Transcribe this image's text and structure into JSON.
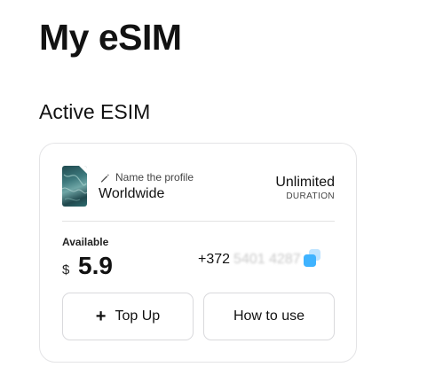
{
  "header": {
    "title": "My eSIM"
  },
  "section": {
    "title": "Active ESIM"
  },
  "esim_card": {
    "profile": {
      "name_hint": "Name the profile",
      "name": "Worldwide",
      "thumbnail_icon": "sim-card-image",
      "edit_icon": "pencil-icon"
    },
    "duration": {
      "value": "Unlimited",
      "label": "DURATION"
    },
    "balance": {
      "label": "Available",
      "currency": "$",
      "amount": "5.9"
    },
    "phone": {
      "prefix": "+372",
      "masked": "5401 4287",
      "copy_icon": "copy-icon"
    },
    "actions": {
      "top_up_label": "Top Up",
      "top_up_icon": "plus-icon",
      "how_to_use_label": "How to use"
    }
  },
  "colors": {
    "accent": "#4db8ff",
    "border": "#e4e4e6",
    "text": "#111111"
  }
}
